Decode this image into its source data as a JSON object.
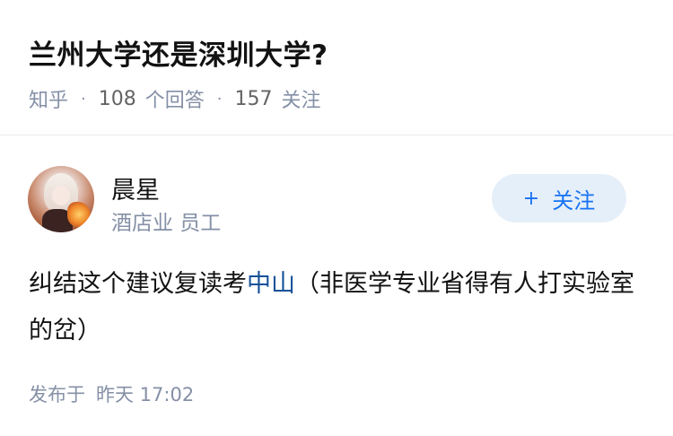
{
  "question": {
    "title": "兰州大学还是深圳大学?",
    "site": "知乎",
    "answer_count": "108",
    "answer_label": "个回答",
    "follower_count": "157",
    "follower_label": "关注",
    "separator": "·"
  },
  "answer": {
    "author_name": "晨星",
    "author_bio": "酒店业 员工",
    "follow_plus": "+",
    "follow_label": "关注",
    "content_before": "纠结这个建议复读考",
    "content_link": "中山",
    "content_after": "（非医学专业省得有人打实验室的岔）",
    "published_label": "发布于",
    "published_time": "昨天 17:02"
  }
}
